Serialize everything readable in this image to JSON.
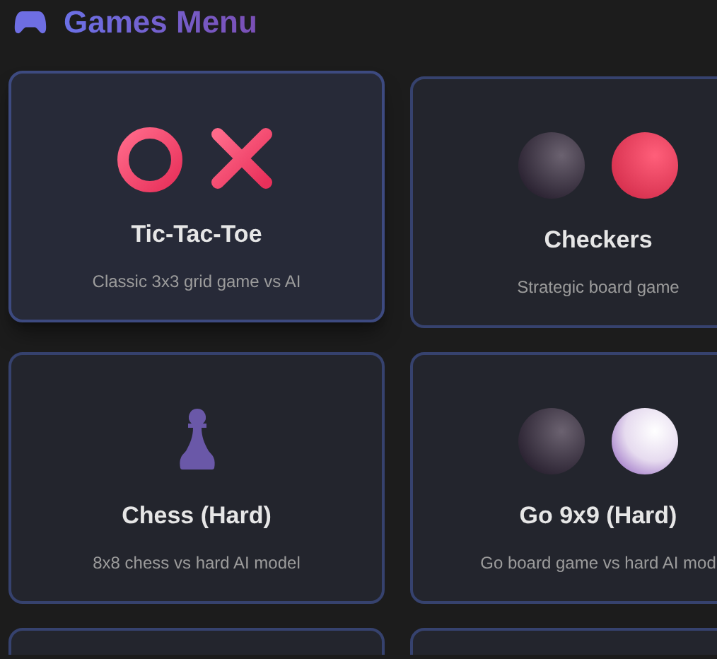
{
  "header": {
    "title": "Games Menu"
  },
  "games": [
    {
      "kind": "tic-tac-toe",
      "title": "Tic-Tac-Toe",
      "description": "Classic 3x3 grid game vs AI",
      "selected": true
    },
    {
      "kind": "checkers",
      "title": "Checkers",
      "description": "Strategic board game",
      "selected": false
    },
    {
      "kind": "chess",
      "title": "Chess (Hard)",
      "description": "8x8 chess vs hard AI model",
      "selected": false
    },
    {
      "kind": "go",
      "title": "Go 9x9 (Hard)",
      "description": "Go board game vs hard AI mod",
      "selected": false
    },
    {
      "kind": "partial",
      "selected": false
    },
    {
      "kind": "partial",
      "selected": false
    }
  ]
}
